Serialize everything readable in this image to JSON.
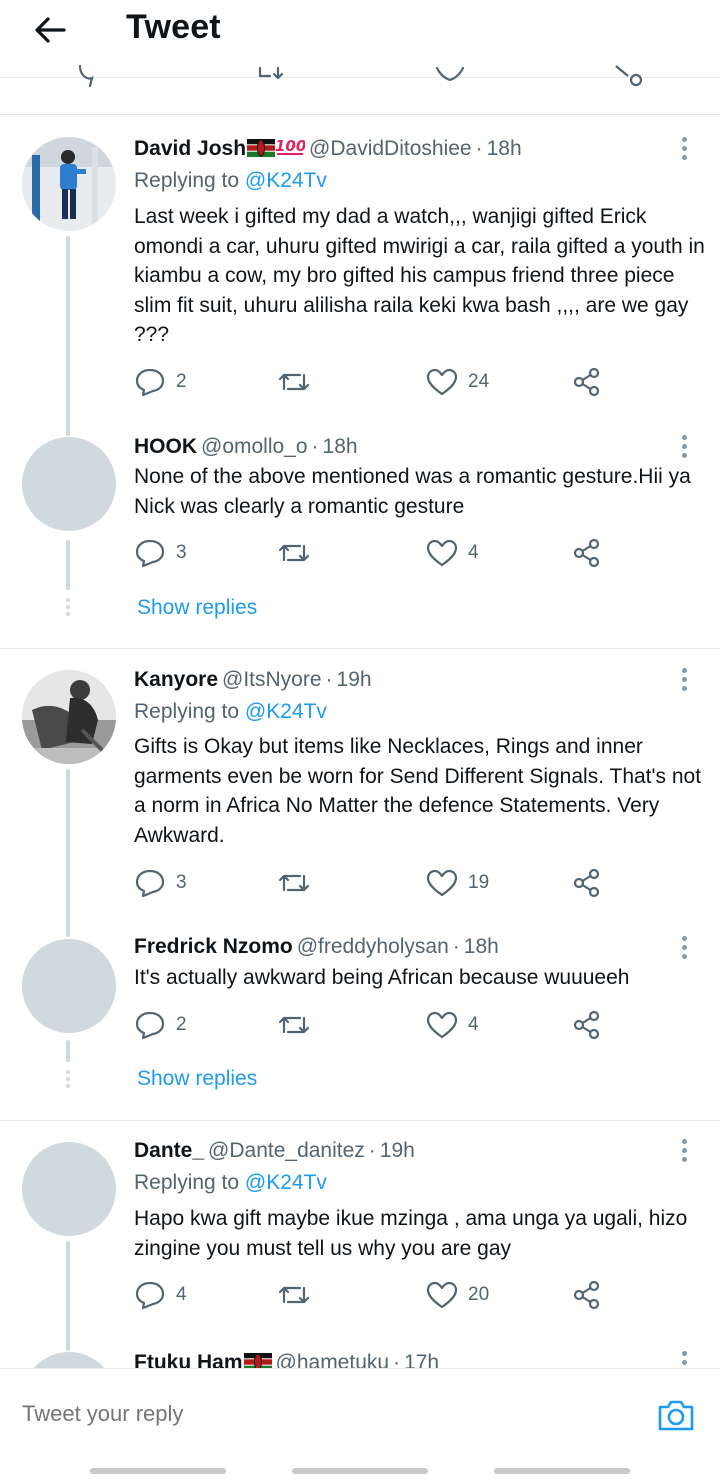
{
  "header": {
    "title": "Tweet",
    "back_icon": "arrow-left-icon"
  },
  "colors": {
    "accent": "#1d9bf0",
    "muted": "#536471",
    "line": "#cfd9de",
    "text": "#0f1419"
  },
  "tweets": [
    {
      "name": "David Josh",
      "badges": [
        "kenya-flag",
        "100-emoji"
      ],
      "handle": "@DavidDitoshiee",
      "time": "18h",
      "replying_label": "Replying to",
      "replying_to": "@K24Tv",
      "text": "Last week i gifted my dad a watch,,, wanjigi gifted Erick omondi a car, uhuru gifted mwirigi a car, raila gifted a youth in kiambu a cow, my bro gifted his campus friend three piece slim fit suit, uhuru alilisha raila keki kwa bash ,,,, are we gay ???",
      "replies": "2",
      "retweets": "",
      "likes": "24"
    },
    {
      "name": "HOOK",
      "handle": "@omollo_o",
      "time": "18h",
      "text": "None of the above mentioned was a  romantic gesture.Hii ya Nick was clearly a romantic gesture",
      "replies": "3",
      "retweets": "",
      "likes": "4"
    },
    {
      "name": "Kanyore",
      "handle": "@ItsNyore",
      "time": "19h",
      "replying_label": "Replying to",
      "replying_to": "@K24Tv",
      "text": "Gifts is Okay but items like Necklaces, Rings and inner garments even be worn for  Send Different Signals. That's not a norm in Africa No Matter the defence Statements. Very Awkward.",
      "replies": "3",
      "retweets": "",
      "likes": "19"
    },
    {
      "name": "Fredrick Nzomo",
      "handle": "@freddyholysan",
      "time": "18h",
      "text": "It's actually awkward being African because wuuueeh",
      "replies": "2",
      "retweets": "",
      "likes": "4"
    },
    {
      "name": "Dante_",
      "handle": "@Dante_danitez",
      "time": "19h",
      "replying_label": "Replying to",
      "replying_to": "@K24Tv",
      "text": "Hapo kwa gift maybe ikue mzinga , ama unga ya ugali, hizo zingine you must tell us why you are gay",
      "replies": "4",
      "retweets": "",
      "likes": "20"
    },
    {
      "name": "Ftuku Ham",
      "handle": "@hametuku",
      "time": "17h"
    }
  ],
  "show_replies_label": "Show replies",
  "reply_bar": {
    "placeholder": "Tweet your reply",
    "camera_icon": "camera-icon"
  }
}
